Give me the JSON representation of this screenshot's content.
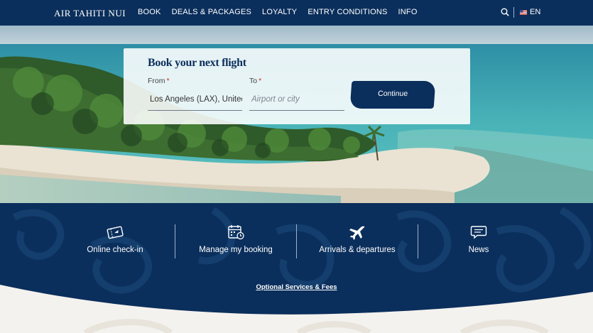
{
  "nav": {
    "logo": "AIR TAHITI NUI",
    "items": [
      {
        "label": "BOOK"
      },
      {
        "label": "DEALS & PACKAGES"
      },
      {
        "label": "LOYALTY"
      },
      {
        "label": "ENTRY CONDITIONS"
      },
      {
        "label": "INFO"
      }
    ],
    "search_icon": "search-icon",
    "flag_icon": "us-flag-icon",
    "language": "EN"
  },
  "booking": {
    "title": "Book your next flight",
    "from_label": "From",
    "from_value": "Los Angeles (LAX), United States",
    "to_label": "To",
    "to_placeholder": "Airport or city",
    "required_mark": "*",
    "continue_label": "Continue"
  },
  "quick_links": [
    {
      "label": "Online check-in",
      "icon": "ticket-icon"
    },
    {
      "label": "Manage my booking",
      "icon": "calendar-clock-icon"
    },
    {
      "label": "Arrivals & departures",
      "icon": "airplane-icon"
    },
    {
      "label": "News",
      "icon": "chat-bubble-icon"
    }
  ],
  "optional_link": "Optional Services & Fees",
  "colors": {
    "brand_navy": "#0b2f5c",
    "required_red": "#c2322c",
    "page_bg": "#f4f2ee"
  }
}
